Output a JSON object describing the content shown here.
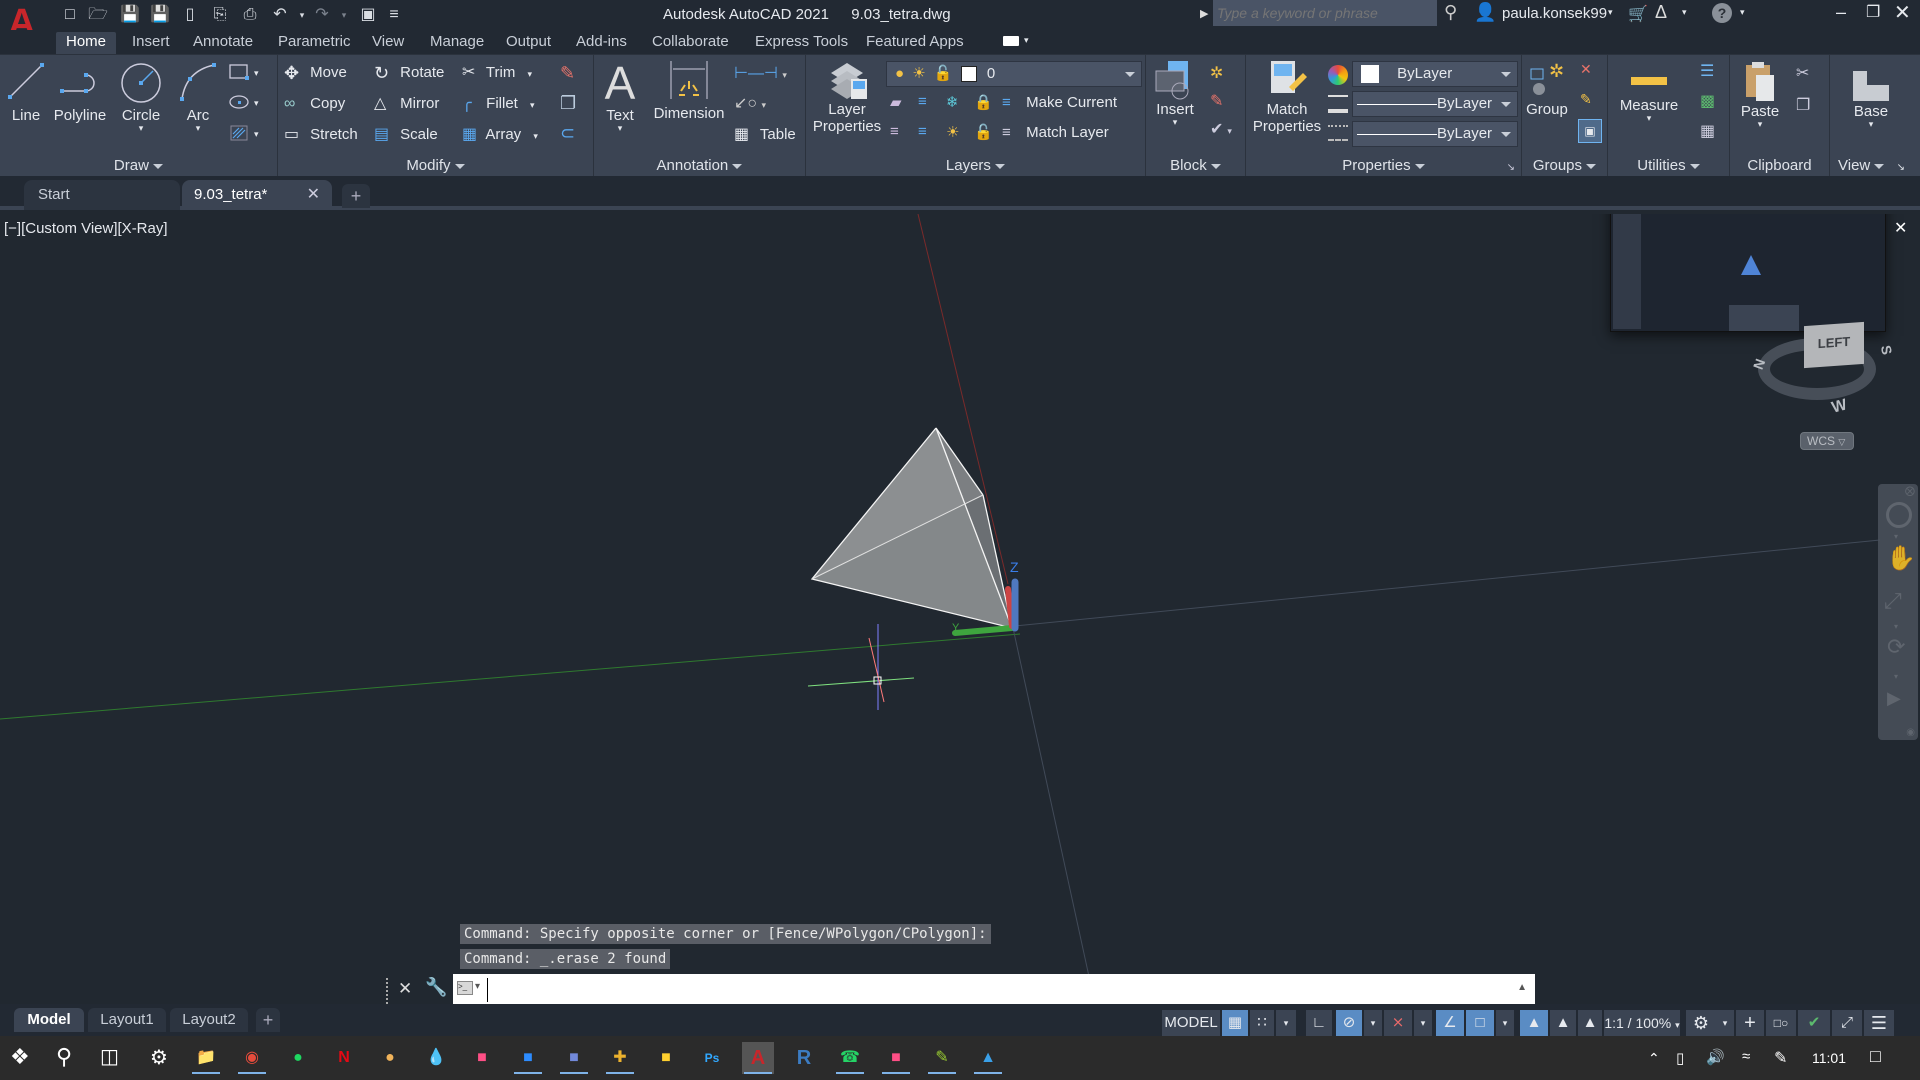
{
  "window": {
    "title": "Autodesk AutoCAD 2021",
    "filename": "9.03_tetra.dwg",
    "search_placeholder": "Type a keyword or phrase",
    "user": "paula.konsek99"
  },
  "ribbon_tabs": [
    "Home",
    "Insert",
    "Annotate",
    "Parametric",
    "View",
    "Manage",
    "Output",
    "Add-ins",
    "Collaborate",
    "Express Tools",
    "Featured Apps"
  ],
  "active_tab": "Home",
  "panels": {
    "draw": {
      "label": "Draw",
      "tools": [
        "Line",
        "Polyline",
        "Circle",
        "Arc"
      ]
    },
    "modify": {
      "label": "Modify",
      "tools": [
        "Move",
        "Rotate",
        "Trim",
        "Copy",
        "Mirror",
        "Fillet",
        "Stretch",
        "Scale",
        "Array"
      ]
    },
    "annotation": {
      "label": "Annotation",
      "tools": [
        "Text",
        "Dimension",
        "Table"
      ]
    },
    "layers": {
      "label": "Layers",
      "layer_properties_1": "Layer",
      "layer_properties_2": "Properties",
      "current_layer": "0",
      "make_current": "Make Current",
      "match_layer": "Match Layer"
    },
    "block": {
      "label": "Block",
      "insert": "Insert"
    },
    "properties": {
      "label": "Properties",
      "match_1": "Match",
      "match_2": "Properties",
      "color": "ByLayer",
      "lineweight": "ByLayer",
      "linetype": "ByLayer"
    },
    "groups": {
      "label": "Groups",
      "group": "Group"
    },
    "utilities": {
      "label": "Utilities",
      "measure": "Measure"
    },
    "clipboard": {
      "label": "Clipboard",
      "paste": "Paste"
    },
    "view": {
      "label": "View",
      "base": "Base"
    }
  },
  "doc_tabs": [
    {
      "label": "Start",
      "active": false
    },
    {
      "label": "9.03_tetra*",
      "active": true
    }
  ],
  "viewport": {
    "controls": "[−][Custom View][X-Ray]",
    "viewcube_face": "LEFT",
    "compass": {
      "n": "N",
      "s": "S",
      "w": "W"
    },
    "ucs_label": "WCS",
    "ucs_axis_label": "Z",
    "ucs_y_label": "Y"
  },
  "command": {
    "history": [
      "Command: Specify opposite corner or [Fence/WPolygon/CPolygon]:",
      "Command: _.erase 2 found"
    ],
    "input_value": ""
  },
  "layout_tabs": [
    {
      "label": "Model",
      "active": true
    },
    {
      "label": "Layout1",
      "active": false
    },
    {
      "label": "Layout2",
      "active": false
    }
  ],
  "status_bar": {
    "model": "MODEL",
    "scale": "1:1 / 100%"
  },
  "taskbar": {
    "clock": "11:01",
    "apps": [
      "File Explorer",
      "Chrome",
      "Spotify",
      "Netflix",
      "App",
      "Droplet",
      "Creative Cloud",
      "Zoom",
      "Discord",
      "Slack",
      "Miro",
      "Photoshop",
      "AutoCAD",
      "Revit",
      "WhatsApp",
      "Creative Cloud 2",
      "Notepad",
      "Photos"
    ]
  },
  "colors": {
    "accent": "#5a8cc4",
    "ribbon_bg": "#3b4453",
    "viewport_bg": "#212830"
  }
}
